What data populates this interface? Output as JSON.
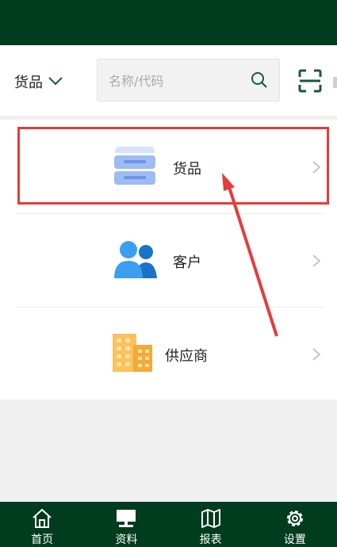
{
  "header": {
    "category_label": "货品",
    "search_placeholder": "名称/代码"
  },
  "menu": {
    "items": [
      {
        "label": "货品",
        "icon": "goods-icon",
        "highlighted": true
      },
      {
        "label": "客户",
        "icon": "customers-icon"
      },
      {
        "label": "供应商",
        "icon": "supplier-building-icon"
      }
    ]
  },
  "tabbar": {
    "tabs": [
      {
        "label": "首页",
        "icon": "home-icon"
      },
      {
        "label": "资料",
        "icon": "monitor-icon"
      },
      {
        "label": "报表",
        "icon": "map-icon"
      },
      {
        "label": "设置",
        "icon": "gear-icon"
      }
    ]
  },
  "colors": {
    "brand_dark_green": "#003c1e",
    "annotation_red": "#e53b3b"
  }
}
